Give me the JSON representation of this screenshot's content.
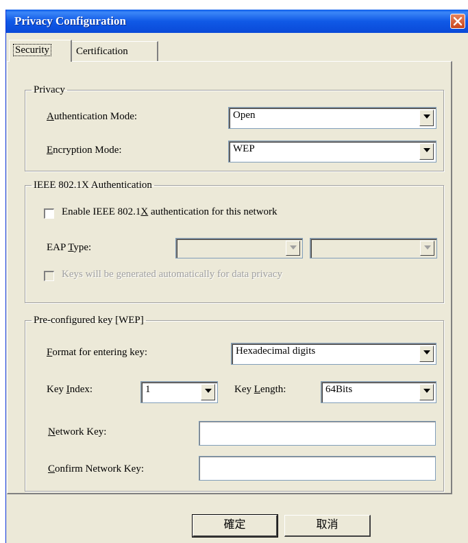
{
  "window": {
    "title": "Privacy Configuration"
  },
  "tabs": [
    {
      "label": "Security"
    },
    {
      "label": "Certification"
    }
  ],
  "privacy": {
    "legend": "Privacy",
    "auth_mode": {
      "label_ul": "A",
      "label_rest": "uthentication Mode:",
      "value": "Open"
    },
    "enc_mode": {
      "label_ul": "E",
      "label_rest": "ncryption Mode:",
      "value": "WEP"
    }
  },
  "ieee": {
    "legend": "IEEE 802.1X Authentication",
    "enable_pre": "Enable IEEE 802.1",
    "enable_ul": "X",
    "enable_post": " authentication for this network",
    "eap_pre": "EAP ",
    "eap_ul": "T",
    "eap_post": "ype:",
    "keys_auto": "Keys will be generated automatically for data privacy"
  },
  "preconfig": {
    "legend": "Pre-configured key [WEP]",
    "format": {
      "label_ul": "F",
      "label_rest": "ormat for entering key:",
      "value": "Hexadecimal digits"
    },
    "key_index": {
      "label_pre": "Key ",
      "label_ul": "I",
      "label_post": "ndex:",
      "value": "1"
    },
    "key_length": {
      "label_pre": "Key ",
      "label_ul": "L",
      "label_post": "ength:",
      "value": "64Bits"
    },
    "network_key": {
      "label_ul": "N",
      "label_rest": "etwork Key:",
      "value": ""
    },
    "confirm_key": {
      "label_ul": "C",
      "label_rest": "onfirm Network Key:",
      "value": ""
    }
  },
  "buttons": {
    "ok": "確定",
    "cancel": "取消"
  },
  "icons": {
    "close": "close-icon",
    "dropdown": "chevron-down-icon"
  },
  "colors": {
    "titlebar": "#0A5BEA",
    "dialog_bg": "#ECE9D8",
    "close_button": "#C8451B"
  }
}
